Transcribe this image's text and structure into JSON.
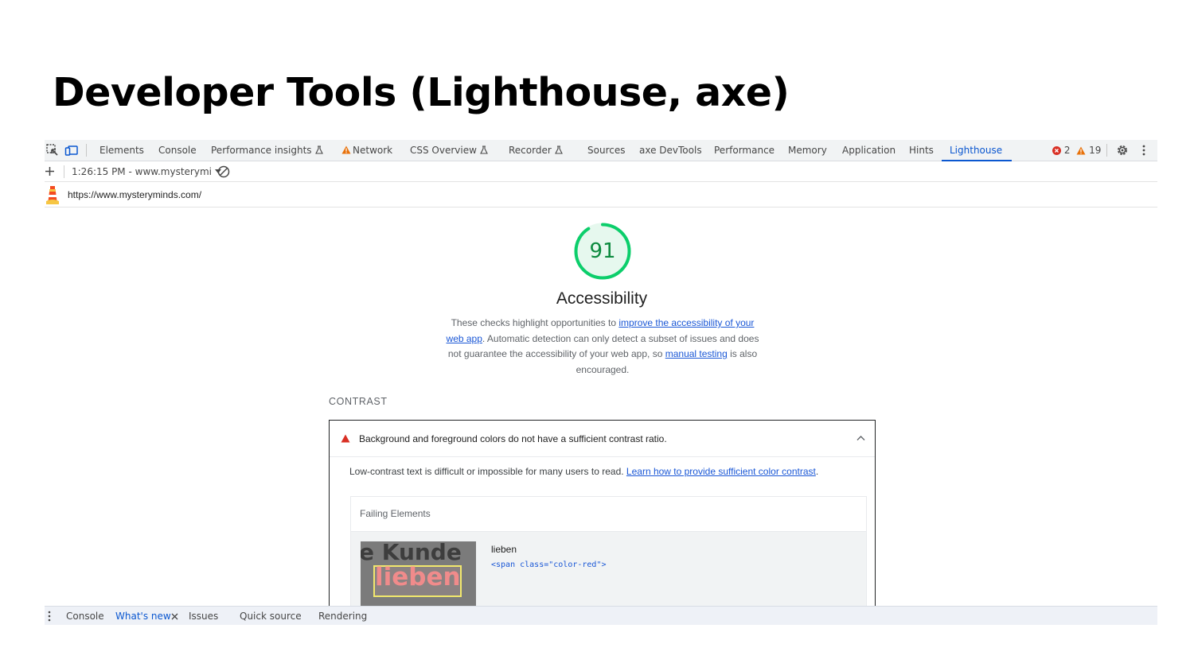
{
  "slide": {
    "title": "Developer Tools (Lighthouse, axe)"
  },
  "devtools": {
    "tabs": [
      {
        "label": "Elements"
      },
      {
        "label": "Console"
      },
      {
        "label": "Performance insights",
        "experimental": true
      },
      {
        "label": "Network",
        "warning": true
      },
      {
        "label": "CSS Overview",
        "experimental": true
      },
      {
        "label": "Recorder",
        "experimental": true
      },
      {
        "label": "Sources"
      },
      {
        "label": "axe DevTools"
      },
      {
        "label": "Performance"
      },
      {
        "label": "Memory"
      },
      {
        "label": "Application"
      },
      {
        "label": "Hints"
      },
      {
        "label": "Lighthouse",
        "active": true
      }
    ],
    "error_count": "2",
    "warning_count": "19",
    "report_selector": "1:26:15 PM - www.mysterymi",
    "url": "https://www.mysteryminds.com/",
    "colors": {
      "accent": "#0b57d0",
      "pass": "#0cce6b",
      "warn": "#e8710a",
      "error": "#d93025"
    }
  },
  "report": {
    "score": "91",
    "score_fraction": 0.91,
    "category_title": "Accessibility",
    "description": {
      "p1": "These checks highlight opportunities to ",
      "link1": "improve the accessibility of your web app",
      "p2": ". Automatic detection can only detect a subset of issues and does not guarantee the accessibility of your web app, so ",
      "link2": "manual testing",
      "p3": " is also encouraged."
    },
    "group_title": "CONTRAST",
    "audit": {
      "title": "Background and foreground colors do not have a sufficient contrast ratio.",
      "desc_text": "Low-contrast text is difficult or impossible for many users to read. ",
      "desc_link": "Learn how to provide sufficient color contrast",
      "desc_end": ".",
      "failing_title": "Failing Elements",
      "node_label": "lieben",
      "node_snippet": "<span class=\"color-red\">",
      "thumb_line1": "e Kunde",
      "thumb_word": "lieben"
    }
  },
  "drawer": {
    "tabs": [
      {
        "label": "Console"
      },
      {
        "label": "What's new",
        "active": true,
        "closable": true
      },
      {
        "label": "Issues"
      },
      {
        "label": "Quick source"
      },
      {
        "label": "Rendering"
      }
    ]
  }
}
